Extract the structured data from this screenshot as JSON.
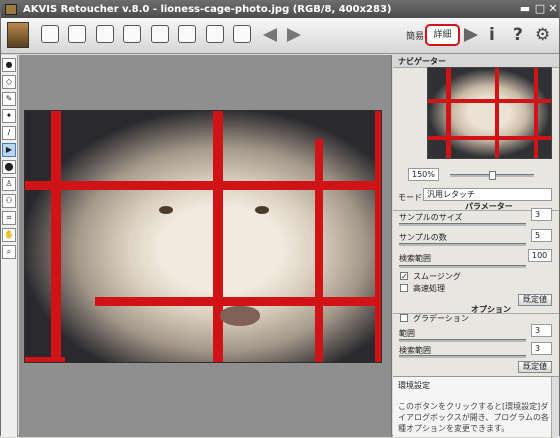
{
  "window": {
    "title": "AKVIS Retoucher v.8.0 - lioness-cage-photo.jpg (RGB/8, 400x283)"
  },
  "toolbar": {
    "mode_simple": "簡易",
    "mode_advanced": "詳細"
  },
  "navigator": {
    "title": "ナビゲーター",
    "zoom": "150%"
  },
  "settings": {
    "mode_label": "モード:",
    "mode_value": "汎用レタッチ",
    "parameters_title": "パラメーター",
    "sample_size_label": "サンプルのサイズ",
    "sample_size_value": "3",
    "sample_count_label": "サンプルの数",
    "sample_count_value": "5",
    "search_range_label": "検索範囲",
    "search_range_value": "100",
    "smoothing_label": "スムージング",
    "smoothing_checked": "✓",
    "fast_label": "高速処理",
    "default_button": "既定値",
    "options_title": "オプション",
    "gradation_label": "グラデーション",
    "range_label": "範囲",
    "range_value": "3",
    "search_range2_label": "検索範囲",
    "search_range2_value": "3",
    "default_button2": "既定値"
  },
  "info": {
    "title": "環境設定",
    "text": "このボタンをクリックすると[環境設定]ダイアログボックスが開き、プログラムの各種オプションを変更できます。"
  }
}
